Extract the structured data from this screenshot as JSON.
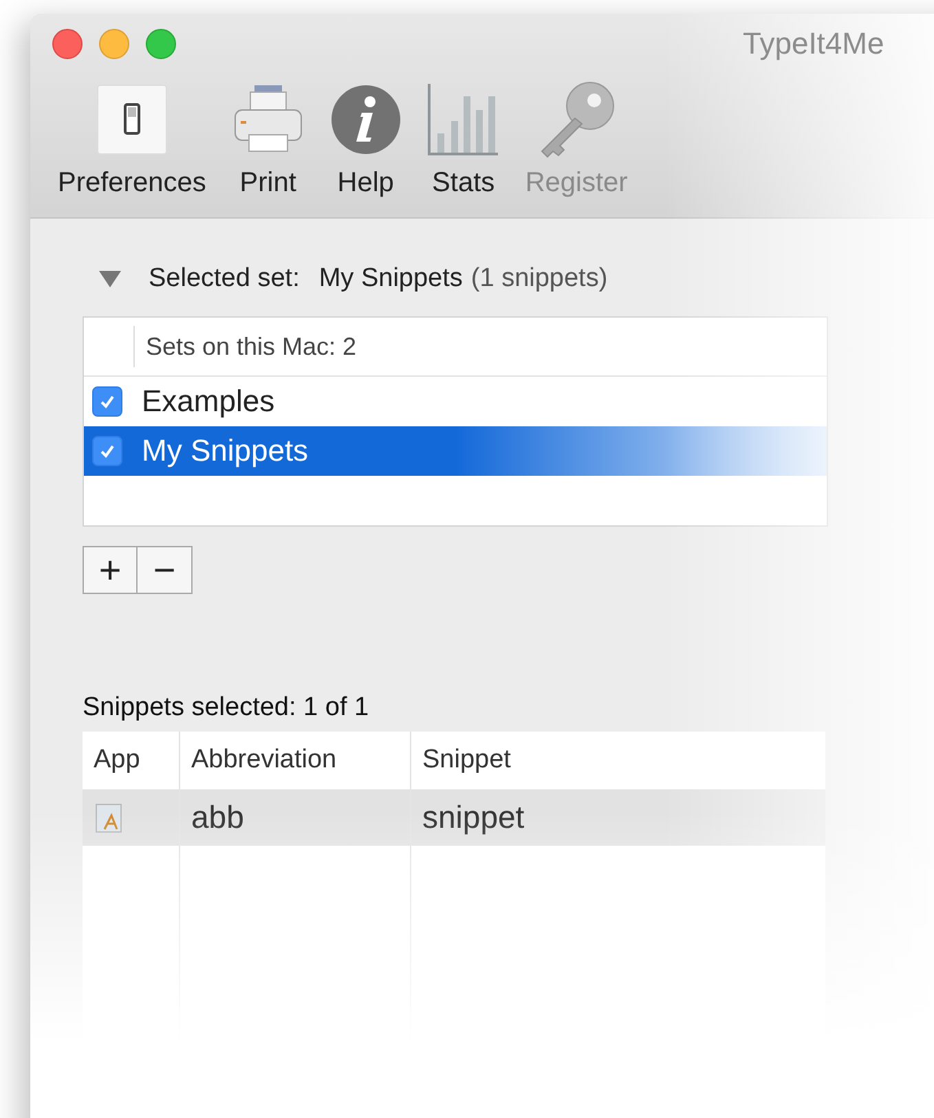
{
  "window": {
    "title": "TypeIt4Me"
  },
  "toolbar": [
    {
      "label": "Preferences",
      "kind": "switch",
      "disabled": false
    },
    {
      "label": "Print",
      "kind": "printer",
      "disabled": false
    },
    {
      "label": "Help",
      "kind": "info",
      "disabled": false
    },
    {
      "label": "Stats",
      "kind": "chart",
      "disabled": false
    },
    {
      "label": "Register",
      "kind": "key",
      "disabled": true
    }
  ],
  "selected_set": {
    "label": "Selected set:",
    "value": "My Snippets",
    "count": "(1 snippets)",
    "expanded": true
  },
  "sets_table": {
    "header": "Sets on this Mac: 2",
    "rows": [
      {
        "name": "Examples",
        "checked": true,
        "selected": false
      },
      {
        "name": "My Snippets",
        "checked": true,
        "selected": true
      }
    ]
  },
  "set_buttons": [
    "+",
    "−"
  ],
  "snippets": {
    "status": "Snippets selected: 1 of 1",
    "columns": [
      "App",
      "Abbreviation",
      "Snippet"
    ],
    "rows": [
      {
        "abbreviation": "abb",
        "snippet": "snippet",
        "selected": true
      }
    ]
  }
}
